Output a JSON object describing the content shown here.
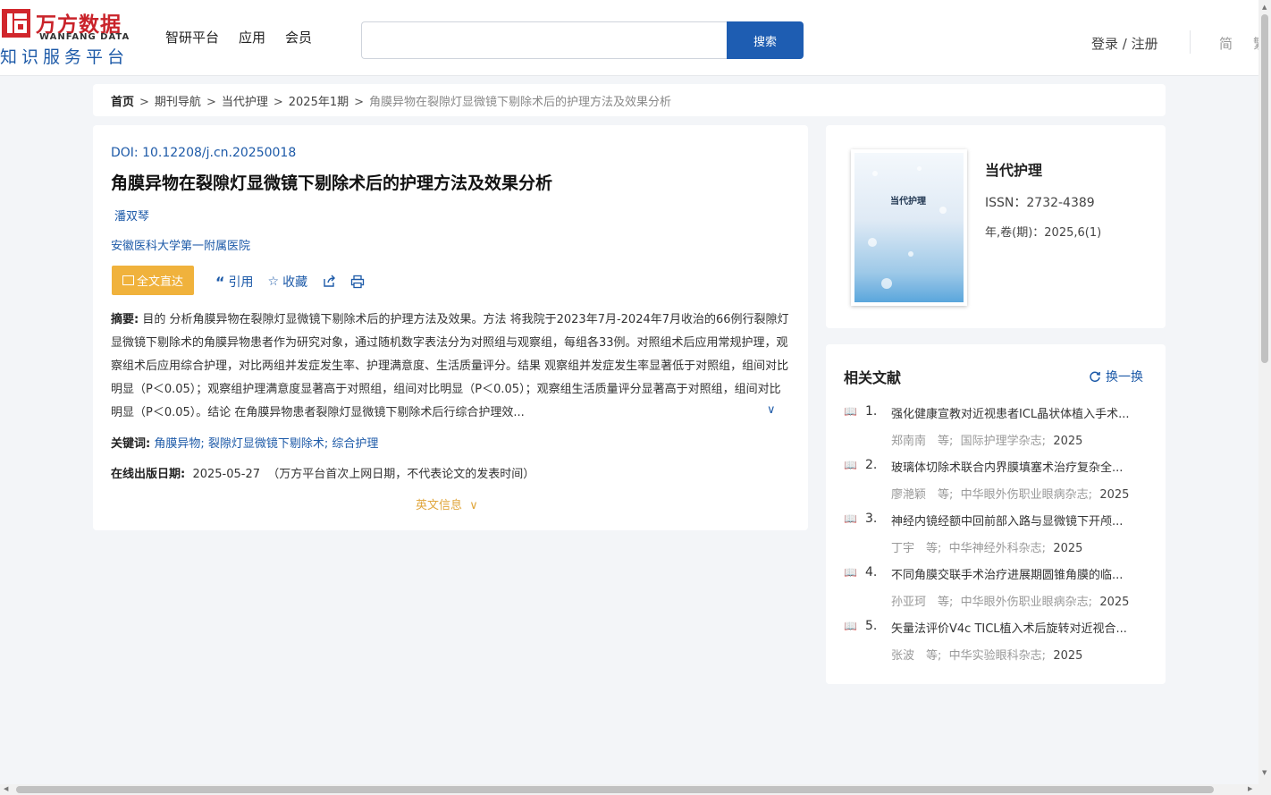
{
  "logo": {
    "cn": "万方数据",
    "en": "WANFANG DATA",
    "sub": "知识服务平台"
  },
  "nav": [
    "智研平台",
    "应用",
    "会员"
  ],
  "search": {
    "value": "",
    "button": "搜索"
  },
  "header": {
    "login": "登录 / 注册",
    "lang": "简",
    "lang2": "繁"
  },
  "breadcrumb": [
    "首页",
    "期刊导航",
    "当代护理",
    "2025年1期",
    "角膜异物在裂隙灯显微镜下剔除术后的护理方法及效果分析"
  ],
  "article": {
    "doi": "DOI: 10.12208/j.cn.20250018",
    "title": "角膜异物在裂隙灯显微镜下剔除术后的护理方法及效果分析",
    "author": "潘双琴",
    "org": "安徽医科大学第一附属医院",
    "fulltext": "全文直达",
    "cite": "引用",
    "collect": "收藏",
    "abstract_label": "摘要:",
    "abstract": "目的 分析角膜异物在裂隙灯显微镜下剔除术后的护理方法及效果。方法 将我院于2023年7月-2024年7月收治的66例行裂隙灯显微镜下剔除术的角膜异物患者作为研究对象，通过随机数字表法分为对照组与观察组，每组各33例。对照组术后应用常规护理，观察组术后应用综合护理，对比两组并发症发生率、护理满意度、生活质量评分。结果 观察组并发症发生率显著低于对照组，组间对比明显（P＜0.05）；观察组护理满意度显著高于对照组，组间对比明显（P＜0.05）；观察组生活质量评分显著高于对照组，组间对比明显（P＜0.05）。结论 在角膜异物患者裂隙灯显微镜下剔除术后行综合护理效...",
    "keywords_label": "关键词:",
    "keywords": [
      "角膜异物",
      "裂隙灯显微镜下剔除术",
      "综合护理"
    ],
    "pubdate_label": "在线出版日期:",
    "pubdate": "2025-05-27",
    "pubdate_note": "（万方平台首次上网日期，不代表论文的发表时间）",
    "english_info": "英文信息"
  },
  "journal": {
    "cover_title": "当代护理",
    "name": "当代护理",
    "issn": "ISSN：2732-4389",
    "volume": "年,卷(期)：2025,6(1)"
  },
  "related": {
    "heading": "相关文献",
    "swap": "换一换",
    "items": [
      {
        "num": "1.",
        "title": "强化健康宣教对近视患者ICL晶状体植入手术...",
        "authors": "郑南南　等;",
        "journal": "国际护理学杂志;",
        "year": "2025"
      },
      {
        "num": "2.",
        "title": "玻璃体切除术联合内界膜填塞术治疗复杂全...",
        "authors": "廖滟颖　等;",
        "journal": "中华眼外伤职业眼病杂志;",
        "year": "2025"
      },
      {
        "num": "3.",
        "title": "神经内镜经额中回前部入路与显微镜下开颅...",
        "authors": "丁宇　等;",
        "journal": "中华神经外科杂志;",
        "year": "2025"
      },
      {
        "num": "4.",
        "title": "不同角膜交联手术治疗进展期圆锥角膜的临...",
        "authors": "孙亚珂　等;",
        "journal": "中华眼外伤职业眼病杂志;",
        "year": "2025"
      },
      {
        "num": "5.",
        "title": "矢量法评价V4c TICL植入术后旋转对近视合...",
        "authors": "张波　等;",
        "journal": "中华实验眼科杂志;",
        "year": "2025"
      }
    ]
  }
}
